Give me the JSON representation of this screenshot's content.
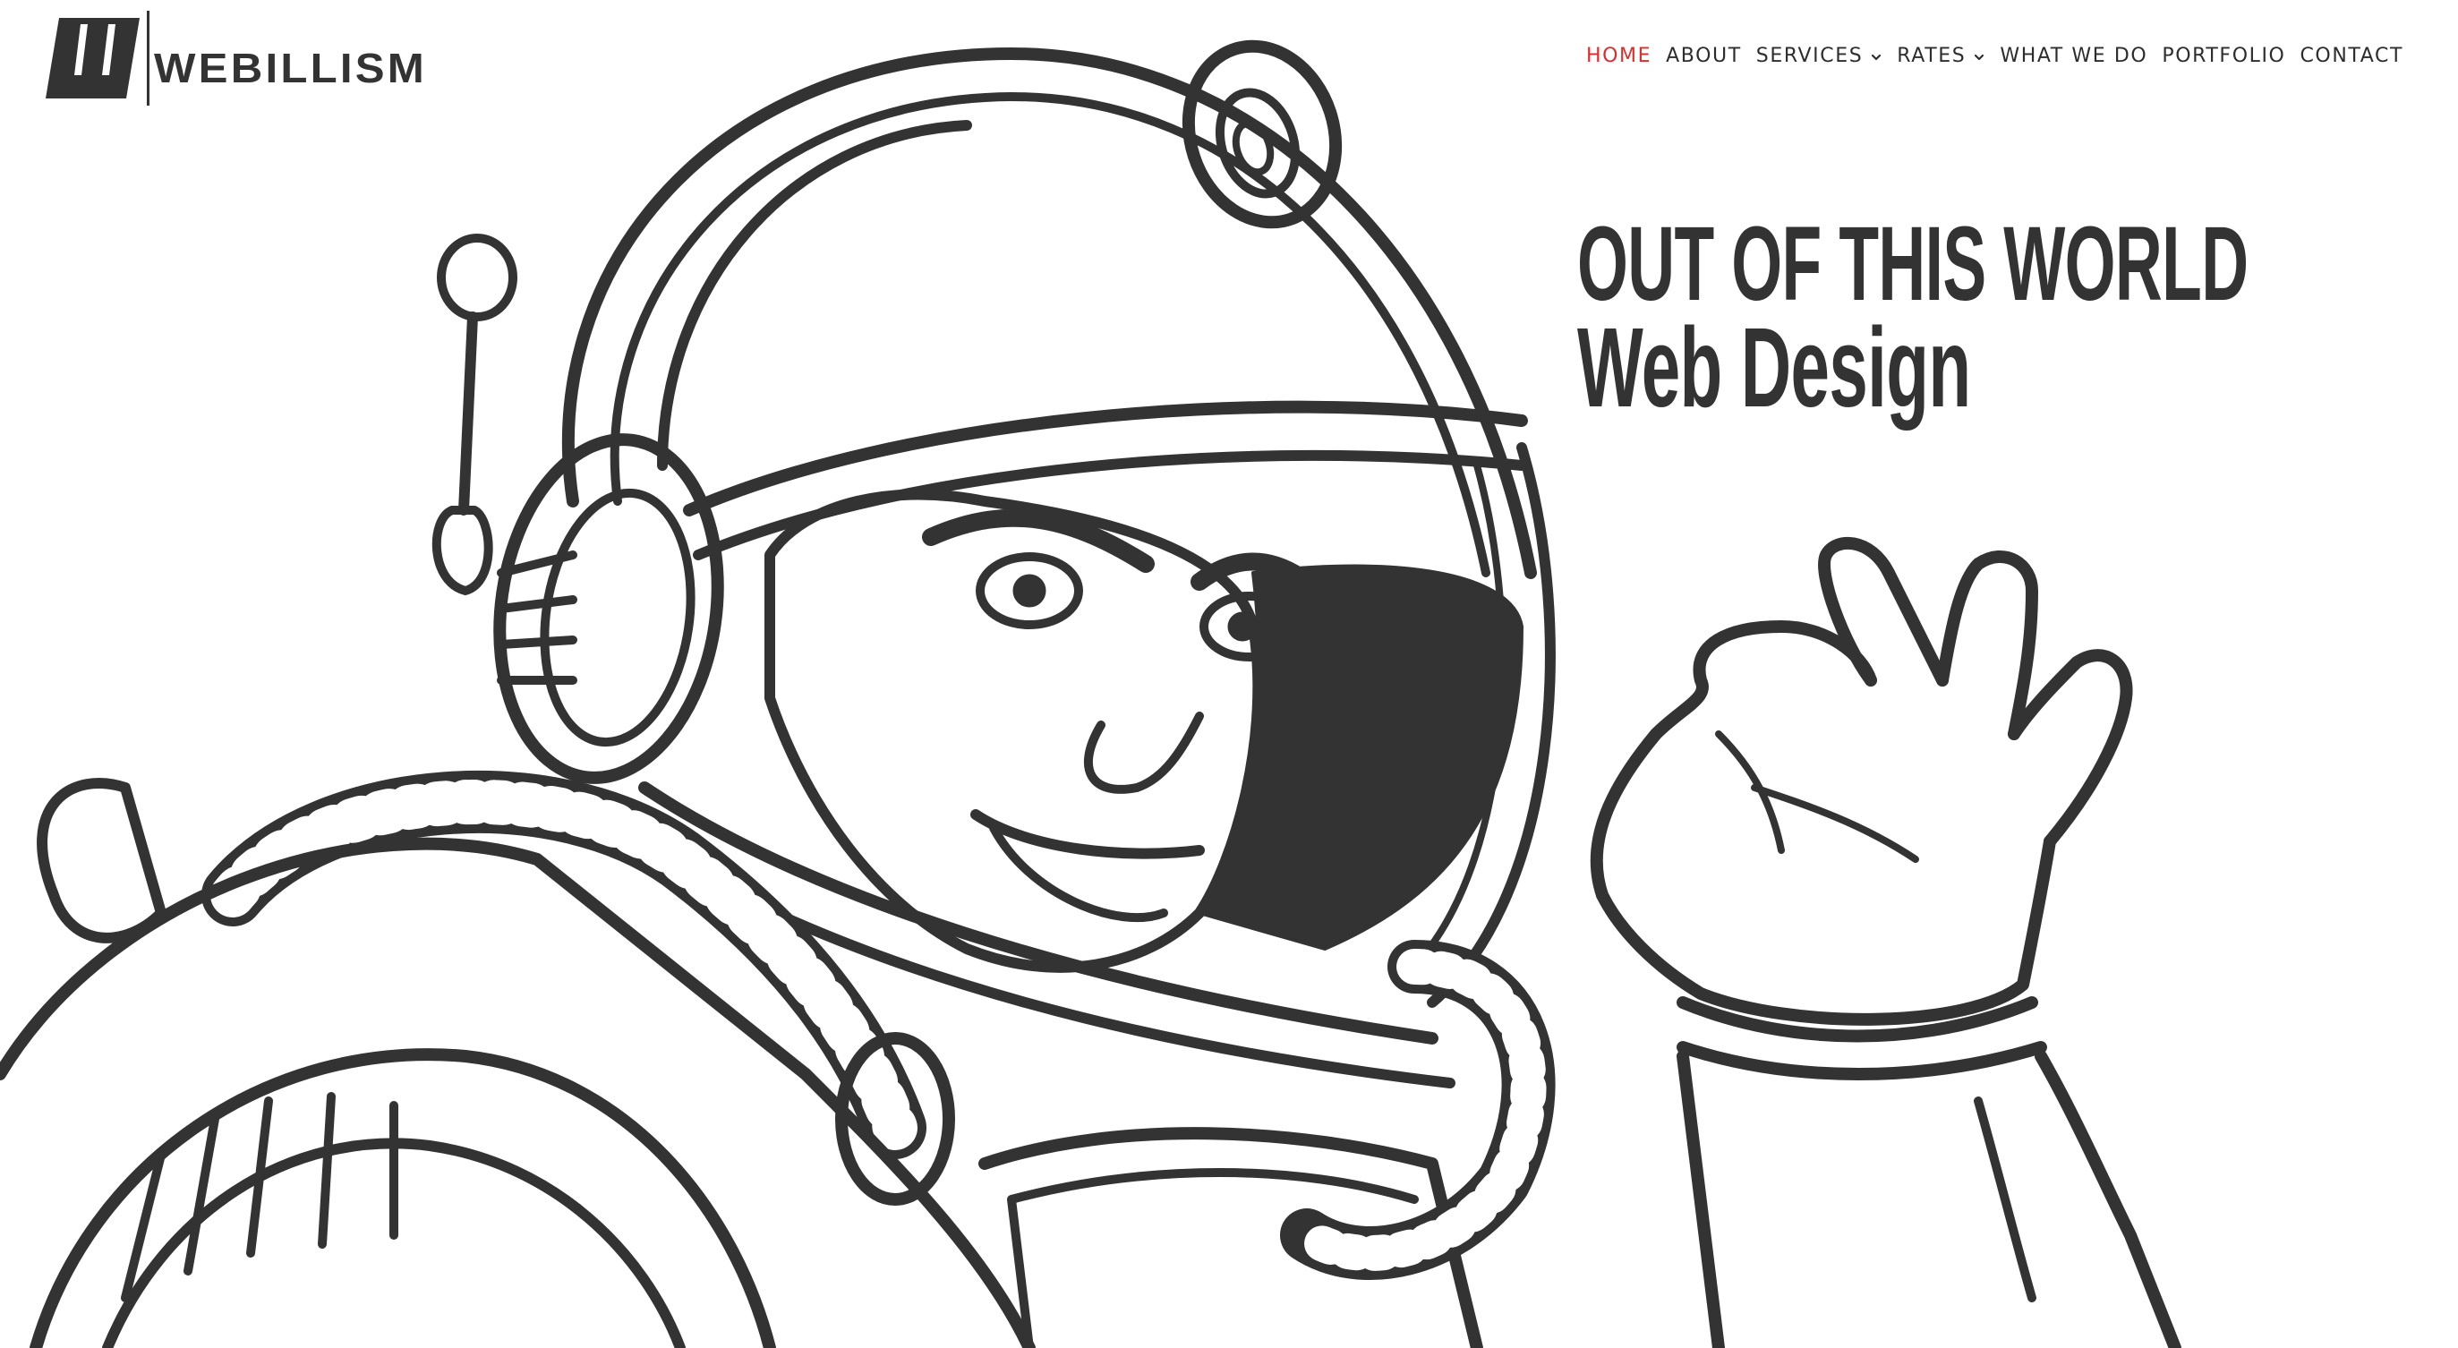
{
  "brand": {
    "name": "WEBILLISM",
    "mark_letter": "W",
    "text_color": "#333333"
  },
  "nav": {
    "active_color": "#e02b2b",
    "text_color": "#2d2d2d",
    "items": [
      {
        "label": "HOME",
        "active": true,
        "has_dropdown": false
      },
      {
        "label": "ABOUT",
        "active": false,
        "has_dropdown": false
      },
      {
        "label": "SERVICES",
        "active": false,
        "has_dropdown": true
      },
      {
        "label": "RATES",
        "active": false,
        "has_dropdown": true
      },
      {
        "label": "WHAT WE DO",
        "active": false,
        "has_dropdown": false
      },
      {
        "label": "PORTFOLIO",
        "active": false,
        "has_dropdown": false
      },
      {
        "label": "CONTACT",
        "active": false,
        "has_dropdown": false
      }
    ]
  },
  "hero": {
    "headline_line1": "OUT OF THIS WORLD",
    "headline_line2": "Web Design",
    "illustration": "retro-astronaut-line-art-icon",
    "ink_color": "#333333"
  }
}
